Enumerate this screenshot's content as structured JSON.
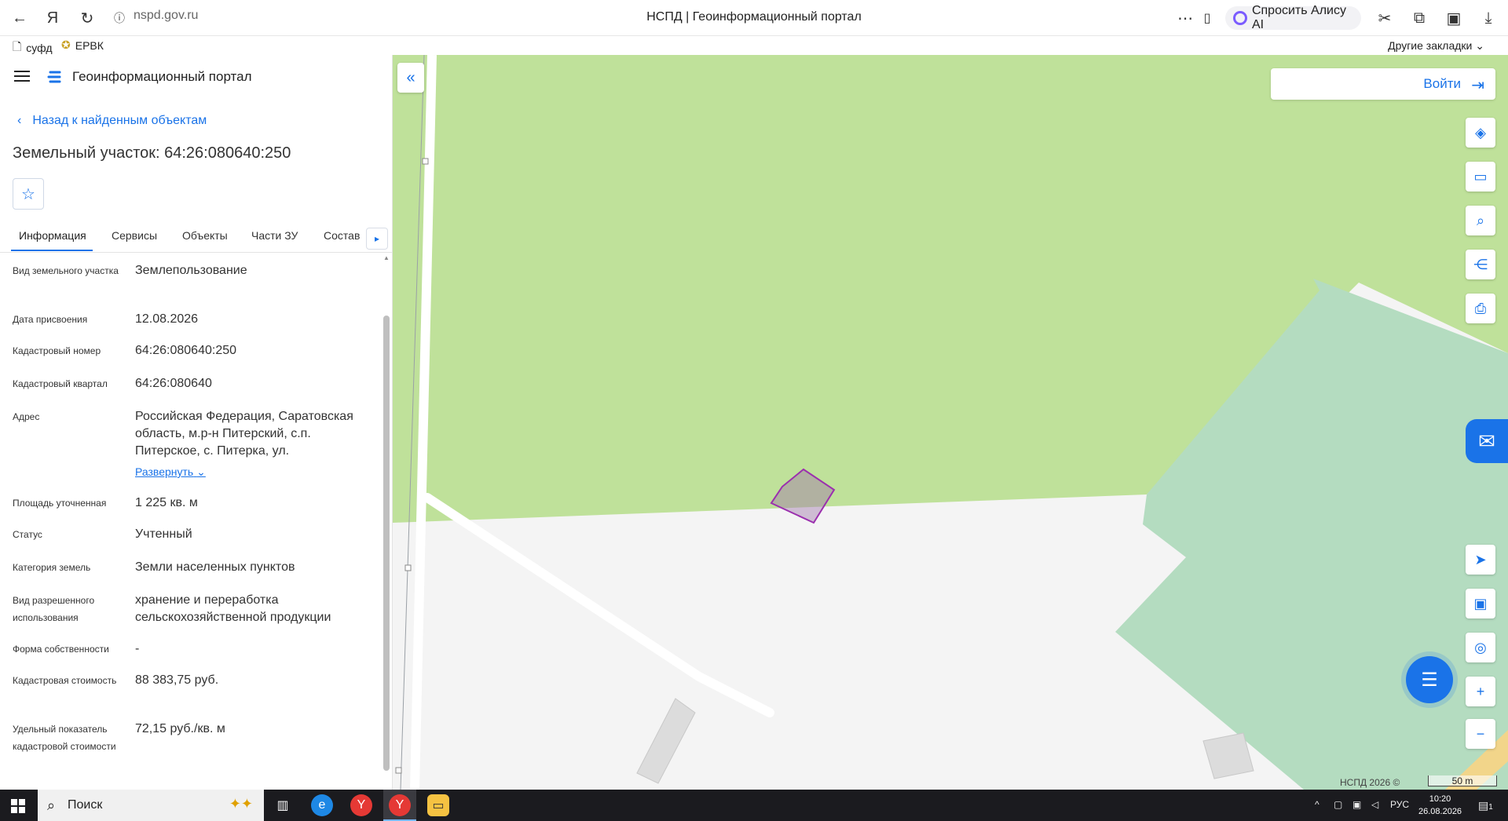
{
  "browser": {
    "url": "nspd.gov.ru",
    "title": "НСПД | Геоинформационный портал",
    "alisa_label": "Спросить Алису AI",
    "bookmarks": [
      "суфд",
      "ЕРВК"
    ],
    "other_bookmarks": "Другие закладки"
  },
  "panel": {
    "portal_title": "Геоинформационный портал",
    "back_label": "Назад к найденным объектам",
    "object_title": "Земельный участок: 64:26:080640:250",
    "tabs": [
      "Информация",
      "Сервисы",
      "Объекты",
      "Части ЗУ",
      "Состав"
    ],
    "rows": [
      {
        "label": "Вид земельного участка",
        "value": "Землепользование"
      },
      {
        "label": "Дата присвоения",
        "value": "12.08.2026"
      },
      {
        "label": "Кадастровый номер",
        "value": "64:26:080640:250"
      },
      {
        "label": "Кадастровый квартал",
        "value": "64:26:080640"
      },
      {
        "label": "Адрес",
        "value": "Российская Федерация, Саратовская область, м.р-н Питерский, с.п. Питерское, с. Питерка, ул.",
        "extra": "Развернуть"
      },
      {
        "label": "Площадь уточненная",
        "value": "1 225 кв. м"
      },
      {
        "label": "Статус",
        "value": "Учтенный"
      },
      {
        "label": "Категория земель",
        "value": "Земли населенных пунктов"
      },
      {
        "label": "Вид разрешенного использования",
        "value": "хранение и переработка сельскохозяйственной продукции"
      },
      {
        "label": "Форма собственности",
        "value": "-"
      },
      {
        "label": "Кадастровая стоимость",
        "value": "88 383,75 руб."
      },
      {
        "label": "Удельный показатель кадастровой стоимости",
        "value": "72,15 руб./кв. м"
      }
    ]
  },
  "map": {
    "login_label": "Войти",
    "copyright": "НСПД 2026 ©",
    "scale": "50 m",
    "colors": {
      "field": "#bfe19a",
      "forest": "#b4dcc0",
      "land": "#f4f4f4",
      "parcel": "#9b2fae",
      "accent": "#1a73e8"
    }
  },
  "taskbar": {
    "search_label": "Поиск",
    "lang": "РУС",
    "time": "10:20",
    "date": "26.08.2026",
    "notifications": "1"
  }
}
